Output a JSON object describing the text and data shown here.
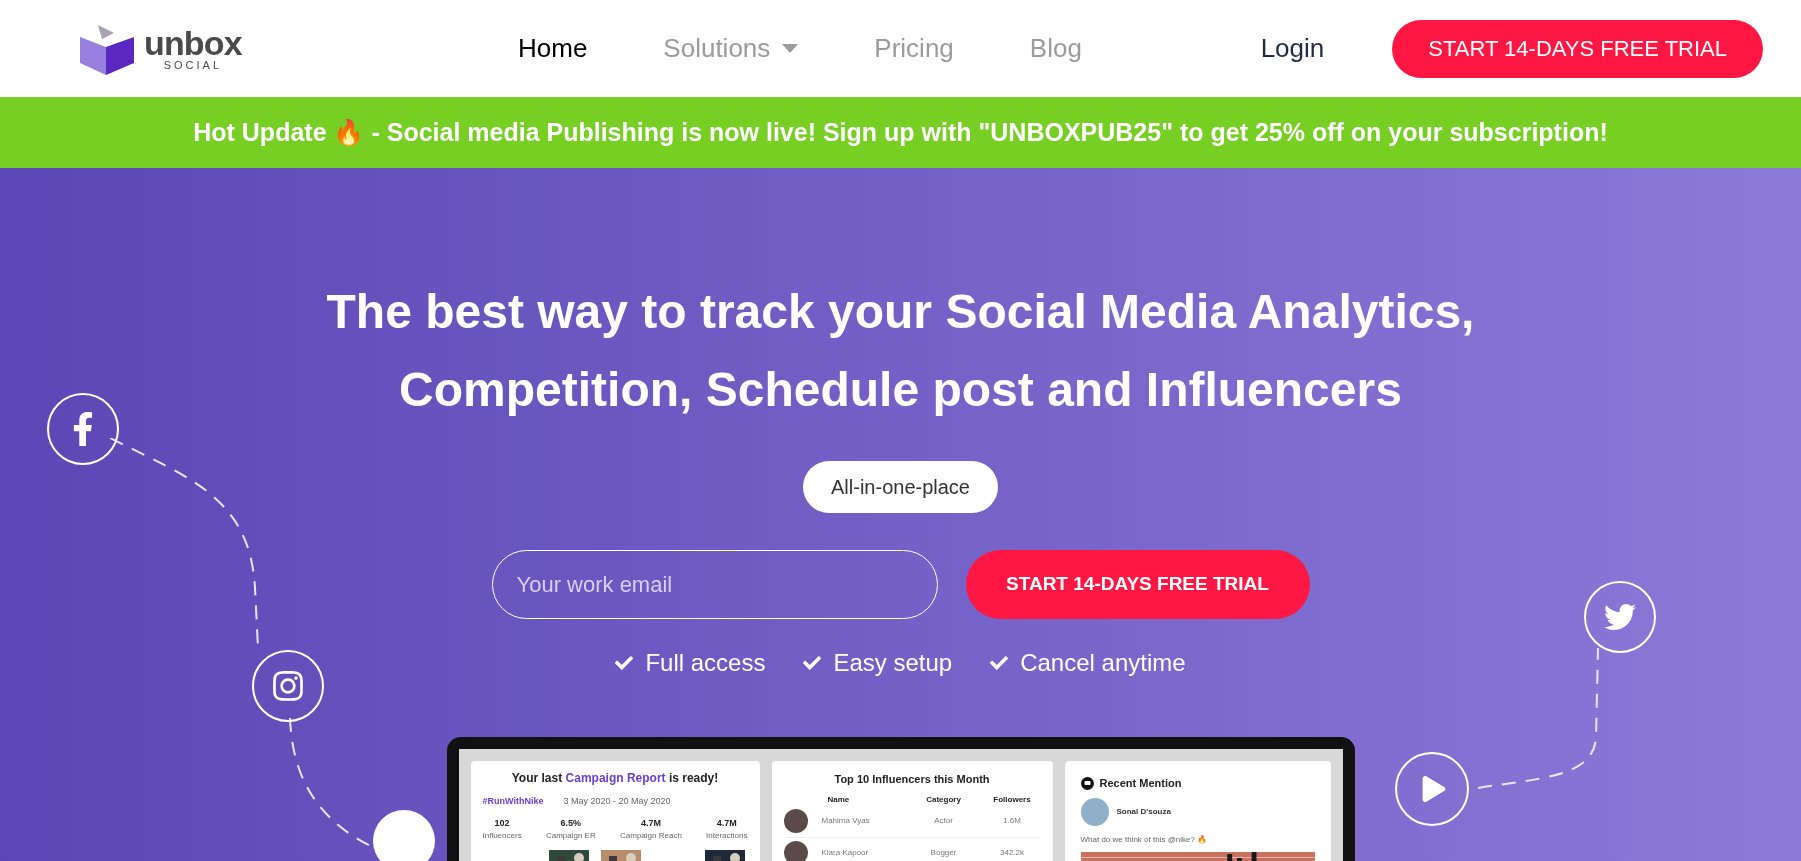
{
  "nav": {
    "logo": {
      "word": "unbox",
      "sub": "SOCIAL"
    },
    "links": [
      {
        "label": "Home",
        "selected": true,
        "dropdown": false
      },
      {
        "label": "Solutions",
        "selected": false,
        "dropdown": true
      },
      {
        "label": "Pricing",
        "selected": false,
        "dropdown": false
      },
      {
        "label": "Blog",
        "selected": false,
        "dropdown": false
      }
    ],
    "login": "Login",
    "cta": "START 14-DAYS FREE TRIAL"
  },
  "banner": "Hot Update 🔥 - Social media Publishing is now live! Sign up with \"UNBOXPUB25\" to get 25% off on your subscription!",
  "hero": {
    "title_lines": [
      "The best way to track your Social Media Analytics,",
      "Competition, Schedule post and Influencers"
    ],
    "pill": "All-in-one-place",
    "email": {
      "placeholder": "Your work email"
    },
    "button": "START 14-DAYS FREE TRIAL",
    "features": [
      "Full access",
      "Easy setup",
      "Cancel anytime"
    ]
  },
  "dashboard": {
    "campaign": {
      "title_before": "Your last",
      "title_link": "Campaign Report",
      "title_after": "is ready!",
      "hashtag": "#RunWithNike",
      "dates": "3 May 2020 - 20 May 2020",
      "stats": [
        {
          "value": "102",
          "label": "Influencers"
        },
        {
          "value": "6.5%",
          "label": "Campaign ER"
        },
        {
          "value": "4.7M",
          "label": "Campaign Reach"
        },
        {
          "value": "4.7M",
          "label": "Interactions"
        }
      ]
    },
    "influencers": {
      "title": "Top 10 Influencers this Month",
      "columns": [
        "Name",
        "Category",
        "Followers"
      ],
      "rows": [
        {
          "name": "Mahima Vyas",
          "category": "Actor",
          "followers": "1.6M"
        },
        {
          "name": "Kiara Kapoor",
          "category": "Bogger",
          "followers": "342.2k"
        }
      ]
    },
    "mention": {
      "title": "Recent Mention",
      "user": "Sonal D'souza",
      "text": "What do we think of this @nike? 🔥"
    }
  }
}
